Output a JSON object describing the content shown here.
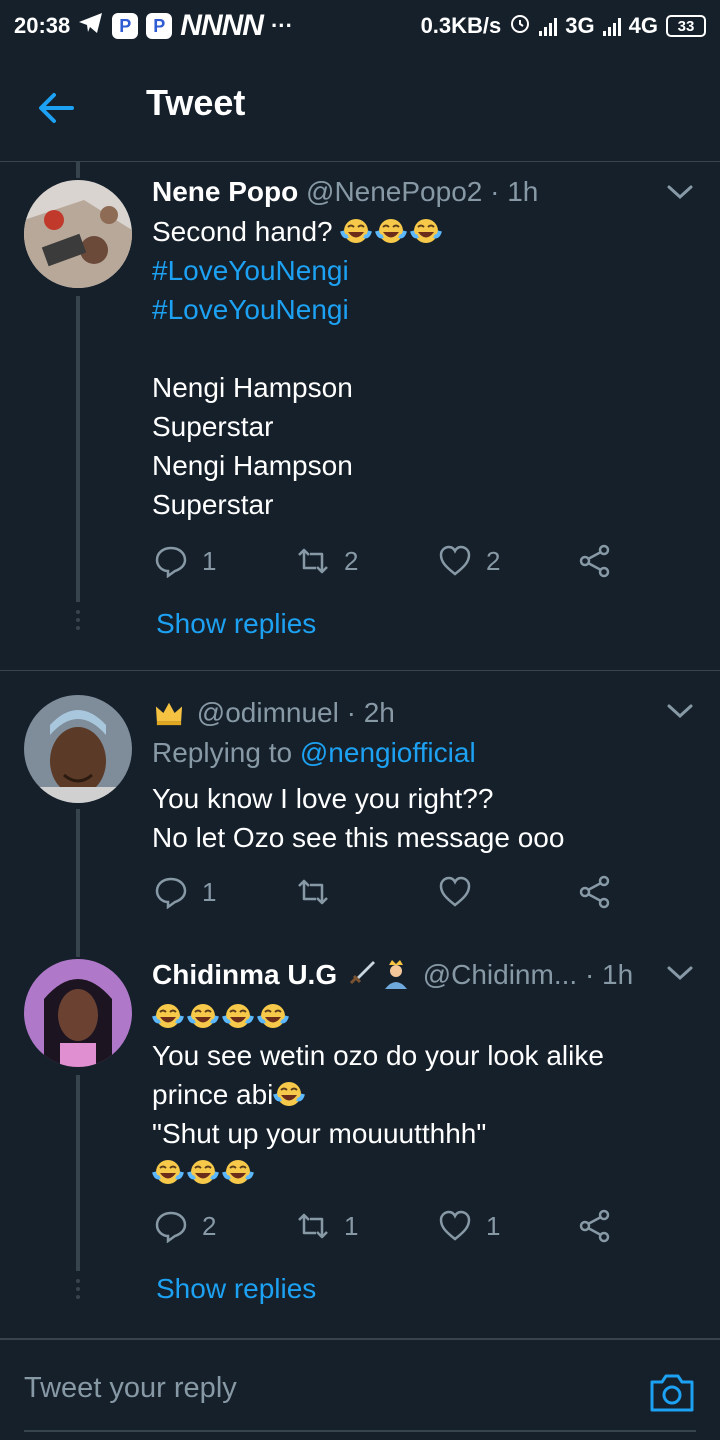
{
  "status_bar": {
    "time": "20:38",
    "app_badges": [
      "P",
      "P"
    ],
    "notification_letters": "NNNN",
    "more": "···",
    "speed": "0.3KB/s",
    "network_1": "3G",
    "network_2": "4G",
    "battery": "33"
  },
  "header": {
    "title": "Tweet",
    "back_icon": "arrow-left-icon"
  },
  "tweets": [
    {
      "name": "Nene Popo",
      "handle": "@NenePopo2",
      "time": "· 1h",
      "lines": [
        "Second hand?",
        "#LoveYouNengi",
        "#LoveYouNengi",
        "",
        "Nengi Hampson",
        "Superstar",
        "Nengi Hampson",
        "Superstar"
      ],
      "replies": "1",
      "retweets": "2",
      "likes": "2",
      "show_replies": "Show replies"
    },
    {
      "name": "",
      "handle": "@odimnuel",
      "time": "· 2h",
      "replying_to_label": "Replying to",
      "replying_to_handle": "@nengiofficial",
      "lines": [
        "You know I love you right??",
        "No let Ozo see this message ooo"
      ],
      "replies": "1",
      "retweets": "",
      "likes": ""
    },
    {
      "name": "Chidinma U.G",
      "handle": "@Chidinm...",
      "time": "· 1h",
      "lines": [
        "",
        "You see wetin ozo do your look alike",
        "prince abi",
        "\"Shut up your mouuutthhh\"",
        ""
      ],
      "replies": "2",
      "retweets": "1",
      "likes": "1",
      "show_replies": "Show replies"
    }
  ],
  "composer": {
    "placeholder": "Tweet your reply",
    "camera_icon": "camera-icon"
  },
  "colors": {
    "background": "#15202b",
    "accent": "#1da1f2",
    "secondary_text": "#8899a6",
    "divider": "#38444d"
  }
}
